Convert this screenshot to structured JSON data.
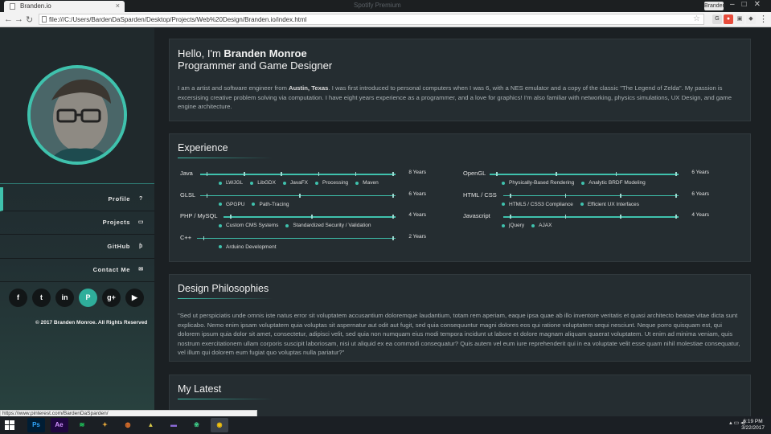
{
  "browser": {
    "tab_title": "Branden.io",
    "tab_close": "×",
    "window_title": "Spotify Premium",
    "user_chip": "Branden",
    "address": "file:///C:/Users/BardenDaSparden/Desktop/Projects/Web%20Design/Branden.io/index.html",
    "status_url": "https://www.pinterest.com/BardenDaSparden/"
  },
  "sidebar": {
    "nav": [
      {
        "label": "Profile",
        "icon": "?"
      },
      {
        "label": "Projects",
        "icon": "▭"
      },
      {
        "label": "GitHub",
        "icon": "ƥ"
      },
      {
        "label": "Contact Me",
        "icon": "✉"
      }
    ],
    "social": [
      {
        "name": "facebook-icon",
        "glyph": "f"
      },
      {
        "name": "twitter-icon",
        "glyph": "t"
      },
      {
        "name": "linkedin-icon",
        "glyph": "in"
      },
      {
        "name": "pinterest-icon",
        "glyph": "P"
      },
      {
        "name": "googleplus-icon",
        "glyph": "g+"
      },
      {
        "name": "youtube-icon",
        "glyph": "▶"
      }
    ],
    "copyright": "© 2017 Branden Monroe. All Rights Reserved"
  },
  "hello": {
    "greeting": "Hello, I'm ",
    "name": "Branden Monroe",
    "role": "Programmer and Game Designer",
    "bio_pre": "I am a artist and software engineer from ",
    "bio_city": "Austin, Texas",
    "bio_post": ". I was first introduced to personal computers when I was 6, with a NES emulator and a copy of the classic \"The Legend of Zelda\". My passion is excersising creative problem solving via computation. I have eight years experience as a programmer, and a love for graphics! I'm also familiar with networking, physics simulations, UX Design, and game engine architecture."
  },
  "experience": {
    "title": "Experience",
    "skills": [
      {
        "name": "Java",
        "years": "8 Years",
        "fraction": 1.0,
        "tags": [
          "LWJGL",
          "LibGDX",
          "JavaFX",
          "Processing",
          "Maven"
        ]
      },
      {
        "name": "GLSL",
        "years": "6 Years",
        "fraction": 1.0,
        "tags": [
          "GPGPU",
          "Path-Tracing"
        ]
      },
      {
        "name": "PHP / MySQL",
        "years": "4 Years",
        "fraction": 1.0,
        "tags": [
          "Custom CMS Systems",
          "Standardized Security / Validation"
        ]
      },
      {
        "name": "C++",
        "years": "2 Years",
        "fraction": 1.0,
        "tags": [
          "Arduino Development"
        ]
      },
      {
        "name": "OpenGL",
        "years": "6 Years",
        "fraction": 1.0,
        "tags": [
          "Physically-Based Rendering",
          "Analytic BRDF Modeling"
        ]
      },
      {
        "name": "HTML / CSS",
        "years": "6 Years",
        "fraction": 1.0,
        "tags": [
          "HTML5 / CSS3 Compliance",
          "Efficient UX Interfaces"
        ]
      },
      {
        "name": "Javascript",
        "years": "4 Years",
        "fraction": 1.0,
        "tags": [
          "jQuery",
          "AJAX"
        ]
      }
    ]
  },
  "philosophy": {
    "title": "Design Philosophies",
    "text": "\"Sed ut perspiciatis unde omnis iste natus error sit voluptatem accusantium doloremque laudantium, totam rem aperiam, eaque ipsa quae ab illo inventore veritatis et quasi architecto beatae vitae dicta sunt explicabo. Nemo enim ipsam voluptatem quia voluptas sit aspernatur aut odit aut fugit, sed quia consequuntur magni dolores eos qui ratione voluptatem sequi nesciunt. Neque porro quisquam est, qui dolorem ipsum quia dolor sit amet, consectetur, adipisci velit, sed quia non numquam eius modi tempora incidunt ut labore et dolore magnam aliquam quaerat voluptatem. Ut enim ad minima veniam, quis nostrum exercitationem ullam corporis suscipit laboriosam, nisi ut aliquid ex ea commodi consequatur? Quis autem vel eum iure reprehenderit qui in ea voluptate velit esse quam nihil molestiae consequatur, vel illum qui dolorem eum fugiat quo voluptas nulla pariatur?\""
  },
  "latest": {
    "title": "My Latest"
  },
  "taskbar": {
    "apps": [
      {
        "name": "photoshop-icon",
        "glyph": "Ps",
        "bg": "#001d34",
        "fg": "#31a8ff"
      },
      {
        "name": "after-effects-icon",
        "glyph": "Ae",
        "bg": "#1f0740",
        "fg": "#d291ff"
      },
      {
        "name": "spotify-icon",
        "glyph": "≋",
        "bg": "#1b1f24",
        "fg": "#1ed760"
      },
      {
        "name": "app-icon-1",
        "glyph": "✦",
        "bg": "#1b1f24",
        "fg": "#e0a43a"
      },
      {
        "name": "blender-icon",
        "glyph": "◍",
        "bg": "#1b1f24",
        "fg": "#f5792a"
      },
      {
        "name": "app-icon-2",
        "glyph": "▲",
        "bg": "#1b1f24",
        "fg": "#d8c84a"
      },
      {
        "name": "app-icon-3",
        "glyph": "▬",
        "bg": "#1b1f24",
        "fg": "#8b6ad6"
      },
      {
        "name": "app-icon-4",
        "glyph": "❀",
        "bg": "#1b1f24",
        "fg": "#3fd08a"
      },
      {
        "name": "chrome-icon",
        "glyph": "◉",
        "bg": "#3a4048",
        "fg": "#f4c20d"
      }
    ],
    "time": "6:19 PM",
    "date": "3/22/2017"
  }
}
